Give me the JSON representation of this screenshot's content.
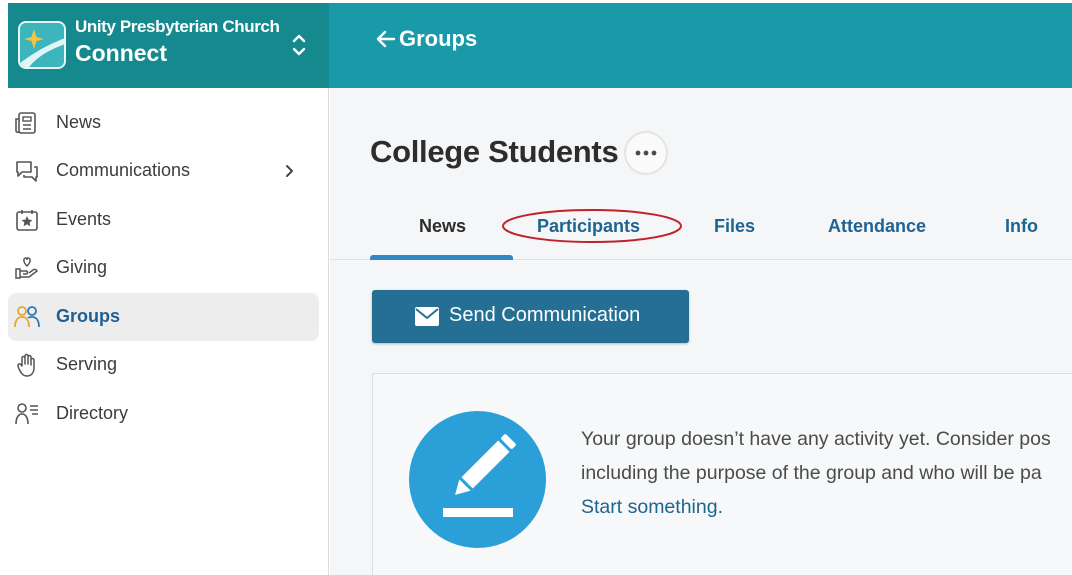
{
  "sidebar_header": {
    "org_name": "Unity Presbyterian Church",
    "app_name": "Connect"
  },
  "topbar": {
    "back_label": "Groups"
  },
  "sidebar": {
    "items": [
      {
        "label": "News",
        "icon": "news-icon"
      },
      {
        "label": "Communications",
        "icon": "chat-icon",
        "has_submenu": true
      },
      {
        "label": "Events",
        "icon": "calendar-star-icon"
      },
      {
        "label": "Giving",
        "icon": "giving-hand-icon"
      },
      {
        "label": "Groups",
        "icon": "people-icon",
        "active": true
      },
      {
        "label": "Serving",
        "icon": "hand-icon"
      },
      {
        "label": "Directory",
        "icon": "directory-icon"
      }
    ]
  },
  "group": {
    "title": "College Students",
    "tabs": [
      {
        "label": "News",
        "active": true
      },
      {
        "label": "Participants",
        "highlighted": true
      },
      {
        "label": "Files"
      },
      {
        "label": "Attendance"
      },
      {
        "label": "Info"
      }
    ],
    "send_button_label": "Send Communication",
    "empty_state": {
      "line1": "Your group doesn’t have any activity yet. Consider pos",
      "line2": "including the purpose of the group and who will be pa",
      "link": "Start something."
    }
  },
  "colors": {
    "header_dark": "#16898f",
    "header": "#1a9aa8",
    "link": "#1f6391",
    "button": "#256f95",
    "accent_blue": "#2a9fd8",
    "annotation_red": "#c0212b"
  }
}
